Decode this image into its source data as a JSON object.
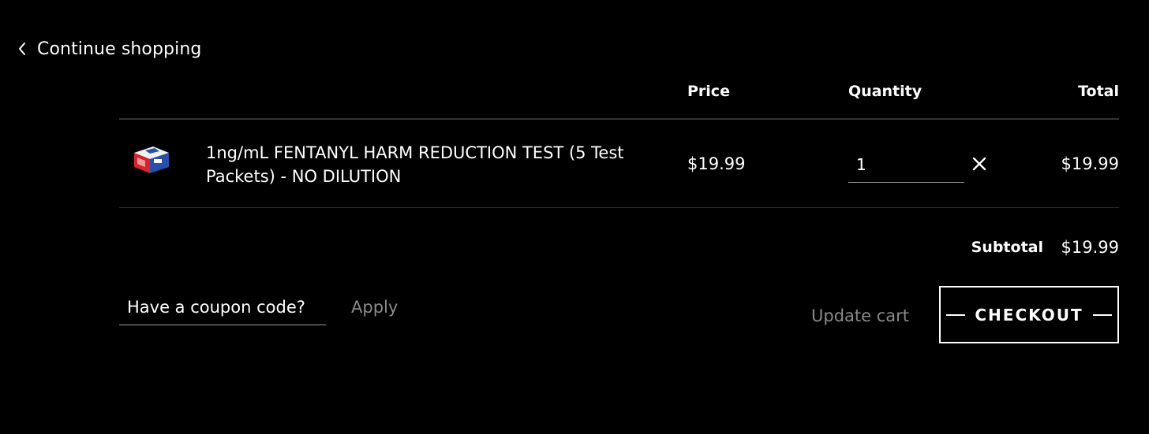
{
  "nav": {
    "continue_label": "Continue shopping"
  },
  "cart": {
    "headers": {
      "price": "Price",
      "quantity": "Quantity",
      "total": "Total"
    },
    "items": [
      {
        "name": "1ng/mL FENTANYL HARM REDUCTION TEST (5 Test Packets) - NO DILUTION",
        "price": "$19.99",
        "quantity": "1",
        "total": "$19.99"
      }
    ],
    "subtotal_label": "Subtotal",
    "subtotal_value": "$19.99"
  },
  "coupon": {
    "placeholder": "Have a coupon code?",
    "apply_label": "Apply"
  },
  "actions": {
    "update_label": "Update cart",
    "checkout_label": "CHECKOUT"
  },
  "icons": {
    "back": "chevron-left-icon",
    "remove": "close-icon",
    "product": "product-box-thumbnail"
  },
  "colors": {
    "background": "#000000",
    "text": "#ffffff",
    "muted": "#8a8a8a",
    "thumbnail_red": "#d8232a",
    "thumbnail_blue": "#2a4fa8"
  }
}
